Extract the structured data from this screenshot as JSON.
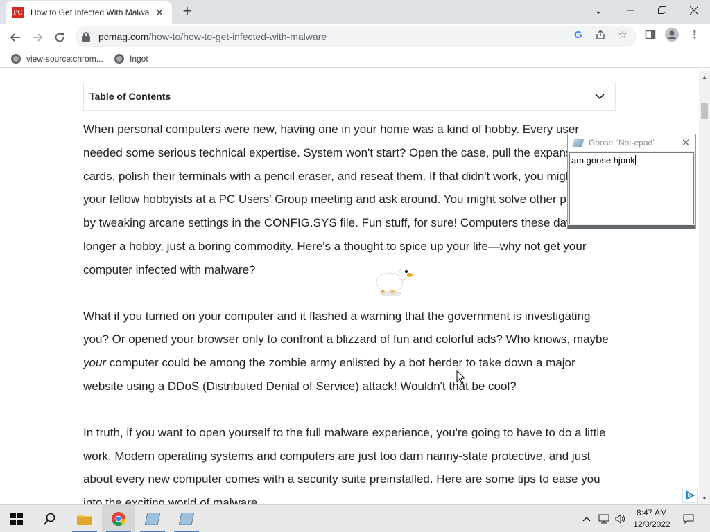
{
  "browser": {
    "tab_title": "How to Get Infected With Malwa",
    "tab_favicon": "PC",
    "url_host": "pcmag.com",
    "url_path": "/how-to/how-to-get-infected-with-malware",
    "bookmarks": [
      "view-source:chrom...",
      "Ingot"
    ]
  },
  "page": {
    "toc_title": "Table of Contents",
    "p1": "When personal computers were new, having one in your home was a kind of hobby. Every user needed some serious technical expertise. System won't start? Open the case, pull the expansion cards, polish their terminals with a pencil eraser, and reseat them. If that didn't work, you might join your fellow hobbyists at a PC Users' Group meeting and ask around. You might solve other problems by tweaking arcane settings in the CONFIG.SYS file. Fun stuff, for sure! Computers these days are no longer a hobby, just a boring commodity. Here's a thought to spice up your life—why not get your computer infected with malware?",
    "p2_a": "What if you turned on your computer and it flashed a warning that the government is investigating you? Or opened your browser only to confront a blizzard of fun and colorful ads? Who knows, maybe ",
    "p2_em": "your",
    "p2_b": " computer could be among the zombie army enlisted by a bot herder to take down a major website using a ",
    "p2_link": "DDoS (Distributed Denial of Service) attack",
    "p2_c": "! Wouldn't that be cool?",
    "p3_a": "In truth, if you want to open yourself to the full malware experience, you're going to have to do a little work. Modern operating systems and computers are just too darn nanny-state protective, and just about every new computer comes with a ",
    "p3_link": "security suite",
    "p3_b": " preinstalled. Here are some tips to ease you into the exciting world of malware."
  },
  "goose_notepad": {
    "title": "Goose \"Not-epad\"",
    "text": "am goose hjonk"
  },
  "taskbar": {
    "time": "8:47 AM",
    "date": "12/8/2022"
  },
  "colors": {
    "accent": "#d7261e",
    "taskbar_active": "#4a7bb5"
  }
}
